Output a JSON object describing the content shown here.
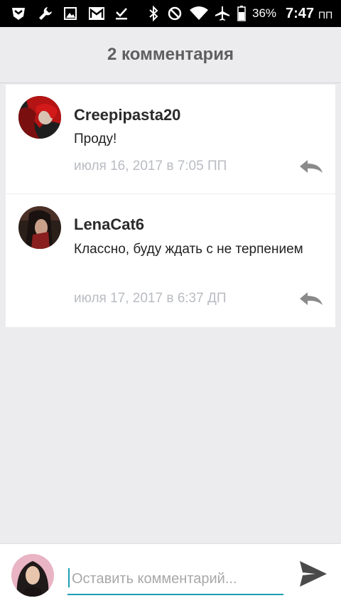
{
  "status_bar": {
    "battery": "36%",
    "time": "7:47",
    "ampm": "ПП",
    "icons": [
      "shield-icon",
      "wrench-icon",
      "image-icon",
      "gmail-icon",
      "download-done-icon",
      "bluetooth-icon",
      "do-not-disturb-icon",
      "wifi-icon",
      "airplane-icon",
      "battery-icon"
    ]
  },
  "header": {
    "title": "2 комментария"
  },
  "comments": [
    {
      "author": "Creepipasta20",
      "text": "Проду!",
      "date": "июля 16, 2017 в 7:05 ПП",
      "avatar_colors": [
        "#b51414",
        "#5a1010",
        "#2a2a2a"
      ]
    },
    {
      "author": "LenaCat6",
      "text": "Классно, буду ждать с не терпением",
      "date": "июля 17, 2017 в 6:37 ДП",
      "avatar_colors": [
        "#3c2a22",
        "#c9a08a",
        "#1a1a1a"
      ]
    }
  ],
  "input": {
    "placeholder": "Оставить комментарий...",
    "value": ""
  },
  "colors": {
    "accent": "#1a9fb5",
    "background": "#ececee",
    "meta_text": "#b9bcc2",
    "icon_gray": "#8a8a8a"
  }
}
